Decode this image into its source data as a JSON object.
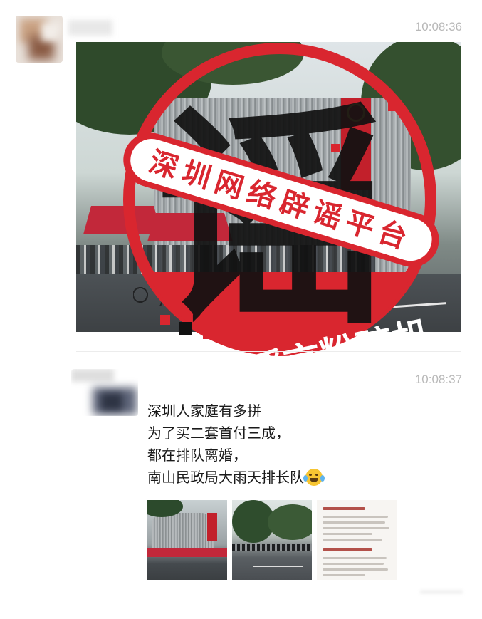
{
  "chat": {
    "messages": [
      {
        "timestamp": "10:08:36",
        "type": "image"
      },
      {
        "timestamp": "10:08:37",
        "type": "text",
        "lines": [
          "深圳人家庭有多拼",
          "为了买二套首付三成，",
          "都在排队离婚，",
          "南山民政局大雨天排长队"
        ],
        "emoji": "crying-laughing-emoji"
      }
    ],
    "thumbnails": [
      "building-photo",
      "queue-photo",
      "document-screenshot"
    ]
  },
  "stamp": {
    "big_char": "谣",
    "band_text": "深圳网络辟谣平台",
    "bottom_text": "谣言粉碎机",
    "color": "#d9262f"
  }
}
